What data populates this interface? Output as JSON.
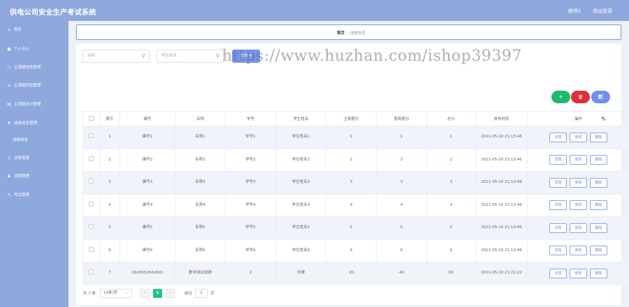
{
  "header": {
    "title": "供电公司安全生产考试系统",
    "role": "教师1",
    "logout": "退出登录"
  },
  "sidebar": {
    "items": [
      {
        "label": "首页",
        "icon": "home-icon",
        "glyph": "⌂"
      },
      {
        "label": "个人中心",
        "icon": "user-icon",
        "glyph": "●"
      },
      {
        "label": "主观题信息管理",
        "icon": "circle-icon",
        "glyph": "○"
      },
      {
        "label": "主观题回答管理",
        "icon": "list-icon",
        "glyph": "≡"
      },
      {
        "label": "主观题评分管理",
        "icon": "score-icon",
        "glyph": "▤"
      },
      {
        "label": "成绩信息管理",
        "icon": "trophy-icon",
        "glyph": "♦"
      },
      {
        "label": "成绩信息",
        "icon": "",
        "glyph": "",
        "sub": true
      },
      {
        "label": "试卷管理",
        "icon": "paper-icon",
        "glyph": "▯"
      },
      {
        "label": "试题管理",
        "icon": "question-icon",
        "glyph": "♟"
      },
      {
        "label": "考试管理",
        "icon": "exam-icon",
        "glyph": "✎"
      }
    ]
  },
  "breadcrumb": {
    "home": "首页",
    "sep": "/",
    "current": "成绩信息"
  },
  "watermark": "https://www.huzhan.com/ishop39397",
  "search": {
    "name_placeholder": "名称",
    "student_placeholder": "学生姓名",
    "button": "查询"
  },
  "actions": {
    "add": "+",
    "delete": "🗑",
    "chart": "📊"
  },
  "colors": {
    "add": "#1fb86f",
    "delete": "#e02f35",
    "chart": "#6f8df3",
    "sidebar": "#8fa8dd",
    "accent": "#7494f0"
  },
  "table": {
    "headers": [
      "",
      "索引",
      "编号",
      "名称",
      "学号",
      "学生姓名",
      "主观题分",
      "客观题分",
      "总分",
      "发布时间",
      "操作"
    ],
    "rows": [
      {
        "idx": "1",
        "code": "编号1",
        "name": "名称1",
        "sno": "学号1",
        "student": "学生姓名1",
        "subj": "1",
        "obj": "1",
        "total": "1",
        "time": "2021-05-10 21:13:46"
      },
      {
        "idx": "2",
        "code": "编号2",
        "name": "名称2",
        "sno": "学号2",
        "student": "学生姓名2",
        "subj": "2",
        "obj": "2",
        "total": "2",
        "time": "2021-05-10 21:13:46"
      },
      {
        "idx": "3",
        "code": "编号3",
        "name": "名称3",
        "sno": "学号3",
        "student": "学生姓名3",
        "subj": "3",
        "obj": "3",
        "total": "3",
        "time": "2021-05-10 21:13:46"
      },
      {
        "idx": "4",
        "code": "编号4",
        "name": "名称4",
        "sno": "学号4",
        "student": "学生姓名4",
        "subj": "4",
        "obj": "4",
        "total": "4",
        "time": "2021-05-10 21:13:46"
      },
      {
        "idx": "5",
        "code": "编号5",
        "name": "名称5",
        "sno": "学号5",
        "student": "学生姓名5",
        "subj": "5",
        "obj": "5",
        "total": "5",
        "time": "2021-05-10 21:13:46"
      },
      {
        "idx": "6",
        "code": "编号6",
        "name": "名称6",
        "sno": "学号6",
        "student": "学生姓名6",
        "subj": "6",
        "obj": "6",
        "total": "6",
        "time": "2021-05-10 21:13:46"
      },
      {
        "idx": "7",
        "code": "1620652942601",
        "name": "数学测试成绩",
        "sno": "2",
        "student": "刘博",
        "subj": "20",
        "obj": "40",
        "total": "60",
        "time": "2021-05-10 21:22:22"
      }
    ],
    "row_buttons": {
      "detail": "详情",
      "edit": "修改",
      "delete": "删除"
    }
  },
  "pagination": {
    "total": "共 7 条",
    "page_size": "10条/页",
    "prev": "<",
    "current": "1",
    "next": ">",
    "goto_label": "前往",
    "goto_value": "1",
    "page_suffix": "页"
  }
}
